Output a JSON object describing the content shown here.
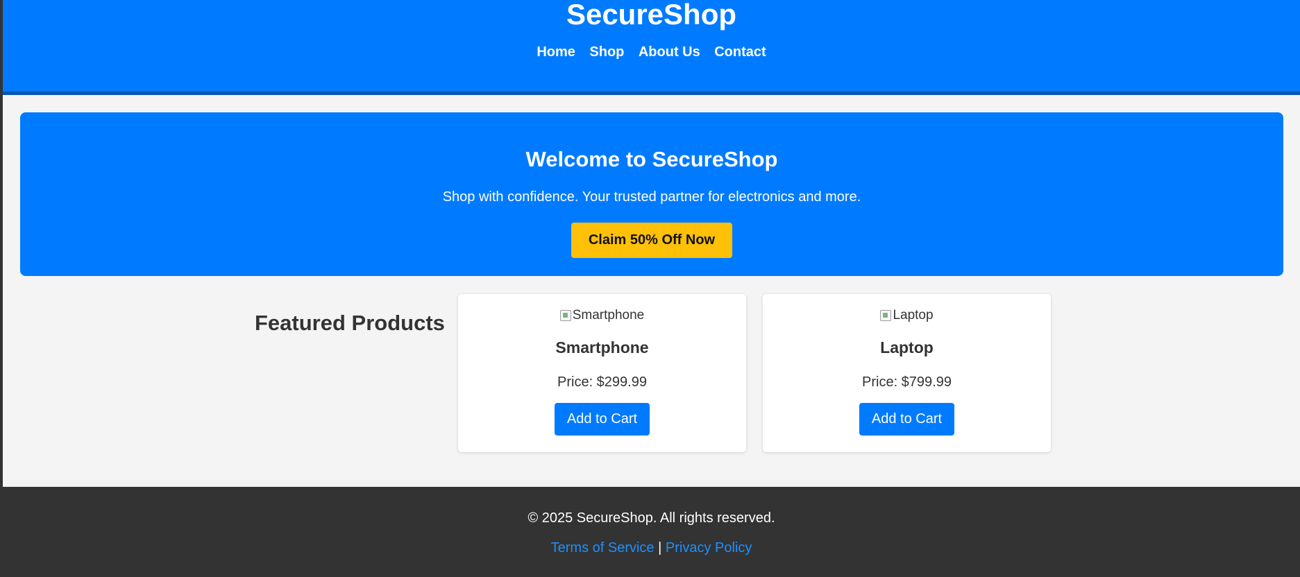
{
  "header": {
    "title": "SecureShop",
    "nav": [
      "Home",
      "Shop",
      "About Us",
      "Contact"
    ]
  },
  "hero": {
    "heading": "Welcome to SecureShop",
    "tagline": "Shop with confidence. Your trusted partner for electronics and more.",
    "cta_label": "Claim 50% Off Now"
  },
  "featured": {
    "heading": "Featured Products",
    "products": [
      {
        "img_alt": "Smartphone",
        "name": "Smartphone",
        "price": "Price: $299.99",
        "button": "Add to Cart"
      },
      {
        "img_alt": "Laptop",
        "name": "Laptop",
        "price": "Price: $799.99",
        "button": "Add to Cart"
      }
    ]
  },
  "footer": {
    "copyright": "© 2025 SecureShop. All rights reserved.",
    "terms": "Terms of Service",
    "separator": "|",
    "privacy": "Privacy Policy"
  },
  "colors": {
    "brand_blue": "#007bff",
    "cta_yellow": "#ffc107",
    "footer_dark": "#333333"
  }
}
